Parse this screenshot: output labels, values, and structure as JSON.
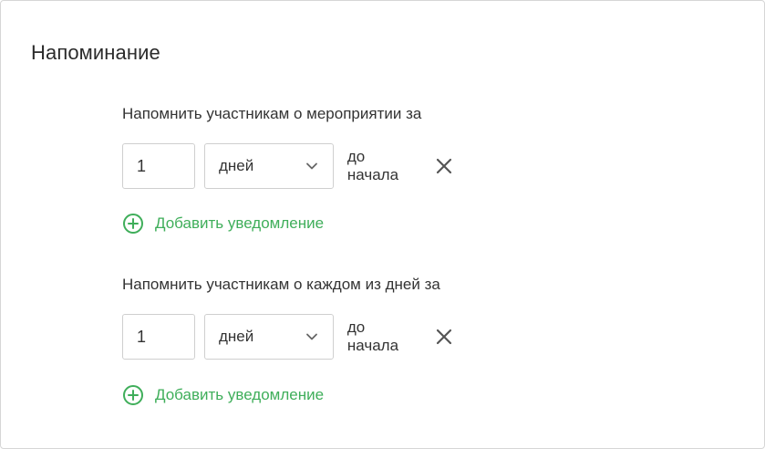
{
  "card": {
    "title": "Напоминание"
  },
  "sections": [
    {
      "label": "Напомнить участникам о мероприятии за",
      "amount": "1",
      "unit": "дней",
      "suffix": "до начала",
      "add_label": "Добавить уведомление"
    },
    {
      "label": "Напомнить участникам о каждом из дней за",
      "amount": "1",
      "unit": "дней",
      "suffix": "до начала",
      "add_label": "Добавить уведомление"
    }
  ],
  "icons": {
    "chevron": "chevron-down-icon",
    "remove": "close-icon",
    "add": "plus-circle-icon"
  },
  "colors": {
    "accent": "#3fae5a",
    "text": "#333333",
    "border": "#cfcfcf",
    "icon": "#555555"
  }
}
